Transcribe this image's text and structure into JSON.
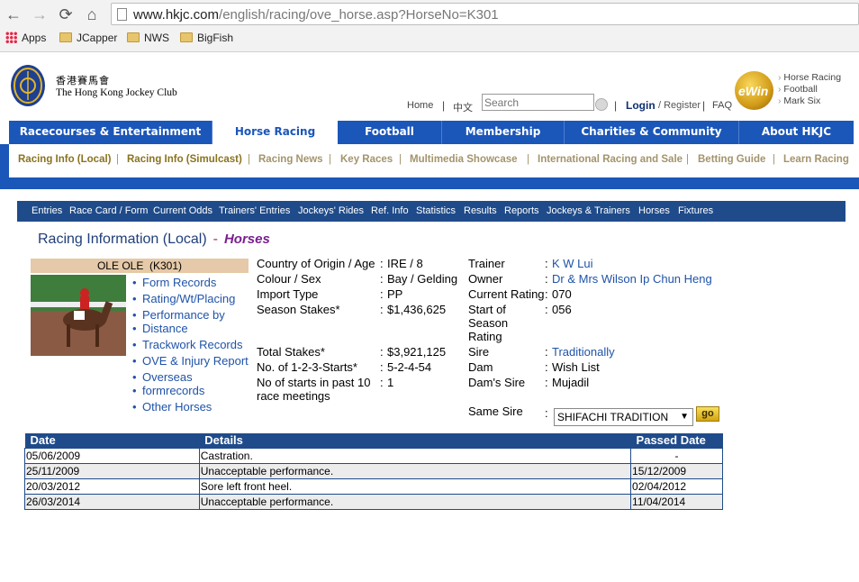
{
  "browser": {
    "url_host": "www.hkjc.com",
    "url_path": "/english/racing/ove_horse.asp?HorseNo=K301",
    "bookmarks": [
      "Apps",
      "JCapper",
      "NWS",
      "BigFish"
    ]
  },
  "header": {
    "club_name_zh": "香港賽馬會",
    "club_name_en": "The Hong Kong Jockey Club",
    "home": "Home",
    "chinese": "中文",
    "search_placeholder": "Search",
    "login": "Login",
    "register": "/ Register",
    "faq": "FAQ",
    "right_links": [
      "Horse Racing",
      "Football",
      "Mark Six"
    ]
  },
  "main_nav": [
    "Racecourses & Entertainment",
    "Horse Racing",
    "Football",
    "Membership",
    "Charities & Community",
    "About HKJC"
  ],
  "sub_nav": [
    "Racing Info (Local)",
    "Racing Info (Simulcast)",
    "Racing News",
    "Key Races",
    "Multimedia Showcase",
    "International Racing and Sale",
    "Betting Guide",
    "Learn Racing"
  ],
  "racing_menu": [
    "Entries",
    "Race Card / Form",
    "Current Odds",
    "Trainers' Entries",
    "Jockeys' Rides",
    "Ref. Info",
    "Statistics",
    "Results",
    "Reports",
    "Jockeys & Trainers",
    "Horses",
    "Fixtures"
  ],
  "page_title": {
    "main": "Racing Information (Local)",
    "dash": "-",
    "sub": "Horses"
  },
  "horse": {
    "name": "OLE OLE  (K301)",
    "links": [
      "Form Records",
      "Rating/Wt/Placing",
      "Performance by",
      "Distance",
      "Trackwork Records",
      "OVE & Injury Report",
      "Overseas",
      "formrecords",
      "Other Horses"
    ],
    "left_fields": [
      {
        "label": "Country of Origin / Age",
        "value": "IRE / 8"
      },
      {
        "label": "Colour / Sex",
        "value": "Bay / Gelding"
      },
      {
        "label": "Import Type",
        "value": "PP"
      },
      {
        "label": "Season Stakes*",
        "value": "$1,436,625"
      },
      {
        "label": "Total Stakes*",
        "value": "$3,921,125"
      },
      {
        "label": "No. of 1-2-3-Starts*",
        "value": "5-2-4-54"
      },
      {
        "label": "No of starts in past 10",
        "label2": "race meetings",
        "value": "1"
      }
    ],
    "right_fields": [
      {
        "label": "Trainer",
        "value": "K W Lui"
      },
      {
        "label": "Owner",
        "value": "Dr & Mrs Wilson Ip Chun Heng"
      },
      {
        "label": "Current Rating",
        "value": "070"
      },
      {
        "label": "Start of",
        "label2": "Season",
        "label3": "Rating",
        "value": "056"
      },
      {
        "label": "Sire",
        "value": "Traditionally"
      },
      {
        "label": "Dam",
        "value": "Wish List"
      },
      {
        "label": "Dam's Sire",
        "value": "Mujadil"
      }
    ],
    "same_sire_label": "Same Sire",
    "same_sire_value": "SHIFACHI TRADITION",
    "go_label": "go",
    "colon": ":"
  },
  "ove_table": {
    "headers": [
      "Date",
      "Details",
      "Passed Date"
    ],
    "rows": [
      [
        "05/06/2009",
        "Castration.",
        "-"
      ],
      [
        "25/11/2009",
        "Unacceptable performance.",
        "15/12/2009"
      ],
      [
        "20/03/2012",
        "Sore left front heel.",
        "02/04/2012"
      ],
      [
        "26/03/2014",
        "Unacceptable performance.",
        "11/04/2014"
      ]
    ]
  }
}
